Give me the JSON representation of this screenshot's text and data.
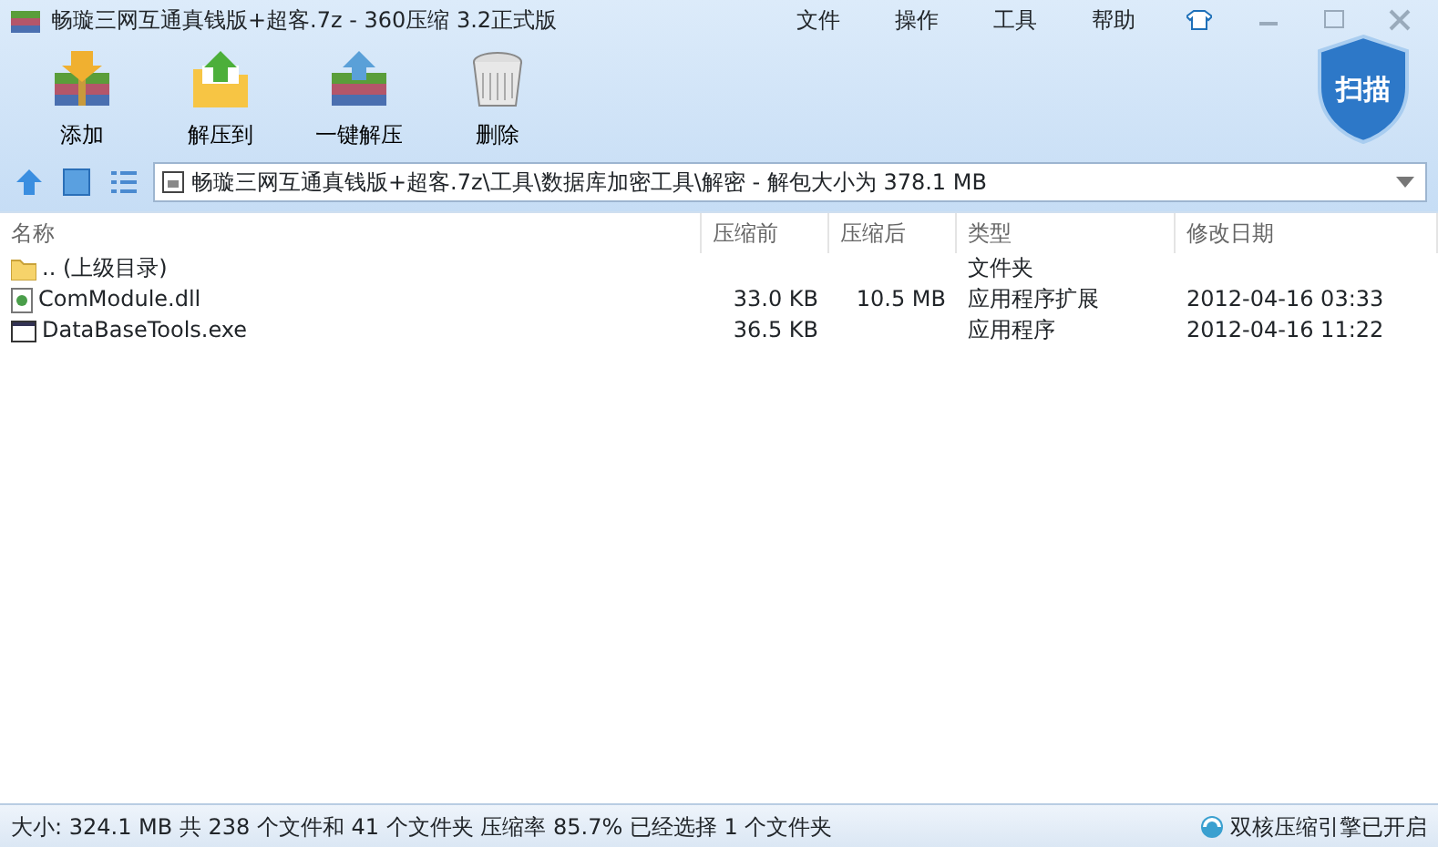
{
  "window": {
    "title": "畅璇三网互通真钱版+超客.7z - 360压缩 3.2正式版"
  },
  "menu": [
    "文件",
    "操作",
    "工具",
    "帮助"
  ],
  "toolbar": [
    {
      "label": "添加",
      "kind": "add"
    },
    {
      "label": "解压到",
      "kind": "extract-to"
    },
    {
      "label": "一键解压",
      "kind": "extract"
    },
    {
      "label": "删除",
      "kind": "delete"
    }
  ],
  "scan_button": {
    "label": "扫描"
  },
  "address": {
    "value": "畅璇三网互通真钱版+超客.7z\\工具\\数据库加密工具\\解密 - 解包大小为 378.1 MB"
  },
  "table": {
    "columns": [
      "名称",
      "压缩前",
      "压缩后",
      "类型",
      "修改日期"
    ],
    "rows": [
      {
        "kind": "folder",
        "cells": [
          ".. (上级目录)",
          "",
          "",
          "文件夹",
          ""
        ]
      },
      {
        "kind": "dll",
        "cells": [
          "ComModule.dll",
          "33.0 KB",
          "10.5 MB",
          "应用程序扩展",
          "2012-04-16 03:33"
        ]
      },
      {
        "kind": "exe",
        "cells": [
          "DataBaseTools.exe",
          "36.5 KB",
          "",
          "应用程序",
          "2012-04-16 11:22"
        ]
      }
    ]
  },
  "status_bar": {
    "text": "大小: 324.1 MB 共 238 个文件和 41 个文件夹 压缩率 85.7% 已经选择 1 个文件夹",
    "engine": "双核压缩引擎已开启"
  }
}
